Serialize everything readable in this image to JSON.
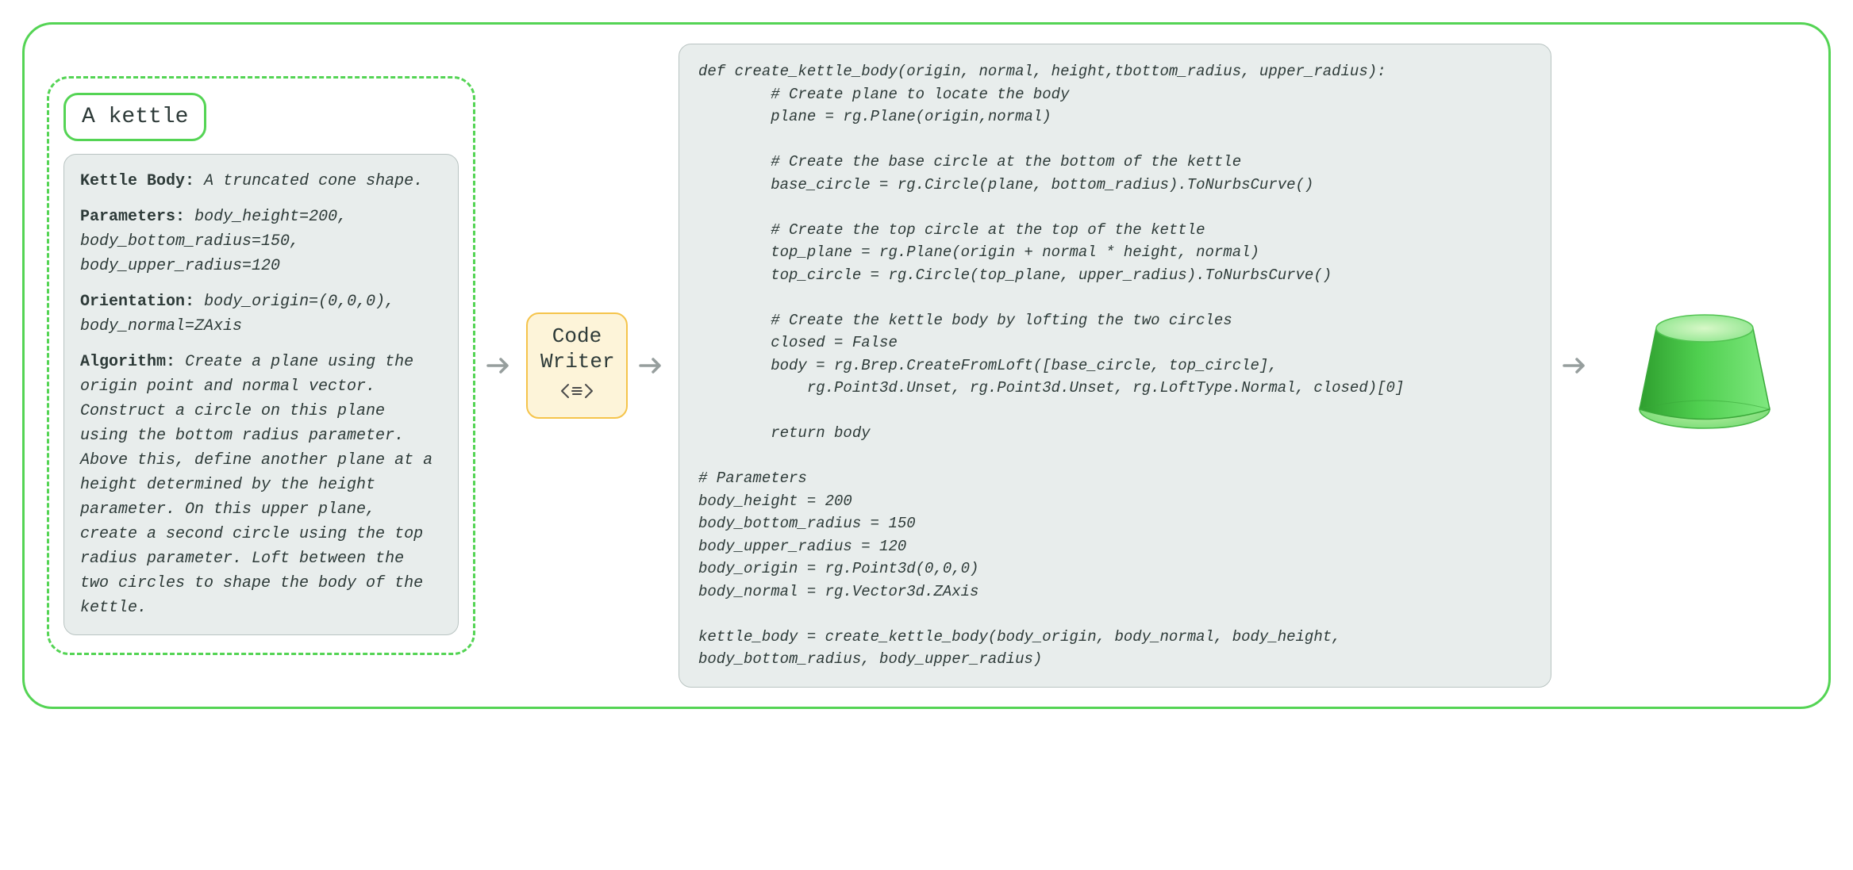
{
  "title": "A kettle",
  "spec": {
    "body_label": "Kettle Body",
    "body_desc": "A truncated cone shape.",
    "params_label": "Parameters",
    "params_desc": "body_height=200, body_bottom_radius=150, body_upper_radius=120",
    "orient_label": "Orientation",
    "orient_desc": "body_origin=(0,0,0), body_normal=ZAxis",
    "algo_label": "Algorithm",
    "algo_desc": "Create a plane using the origin point and normal vector. Construct a circle on this plane using the bottom radius parameter. Above this, define another plane at a height determined by the height parameter. On this upper plane, create a second circle using the top radius parameter. Loft between the two circles to shape the body of the kettle."
  },
  "node": {
    "line1": "Code",
    "line2": "Writer"
  },
  "code": "def create_kettle_body(origin, normal, height,tbottom_radius, upper_radius):\n        # Create plane to locate the body\n        plane = rg.Plane(origin,normal)\n\n        # Create the base circle at the bottom of the kettle\n        base_circle = rg.Circle(plane, bottom_radius).ToNurbsCurve()\n\n        # Create the top circle at the top of the kettle\n        top_plane = rg.Plane(origin + normal * height, normal)\n        top_circle = rg.Circle(top_plane, upper_radius).ToNurbsCurve()\n\n        # Create the kettle body by lofting the two circles\n        closed = False\n        body = rg.Brep.CreateFromLoft([base_circle, top_circle],\n            rg.Point3d.Unset, rg.Point3d.Unset, rg.LoftType.Normal, closed)[0]\n\n        return body\n\n# Parameters\nbody_height = 200\nbody_bottom_radius = 150\nbody_upper_radius = 120\nbody_origin = rg.Point3d(0,0,0)\nbody_normal = rg.Vector3d.ZAxis\n\nkettle_body = create_kettle_body(body_origin, body_normal, body_height,\nbody_bottom_radius, body_upper_radius)",
  "output_shape": "truncated-cone"
}
